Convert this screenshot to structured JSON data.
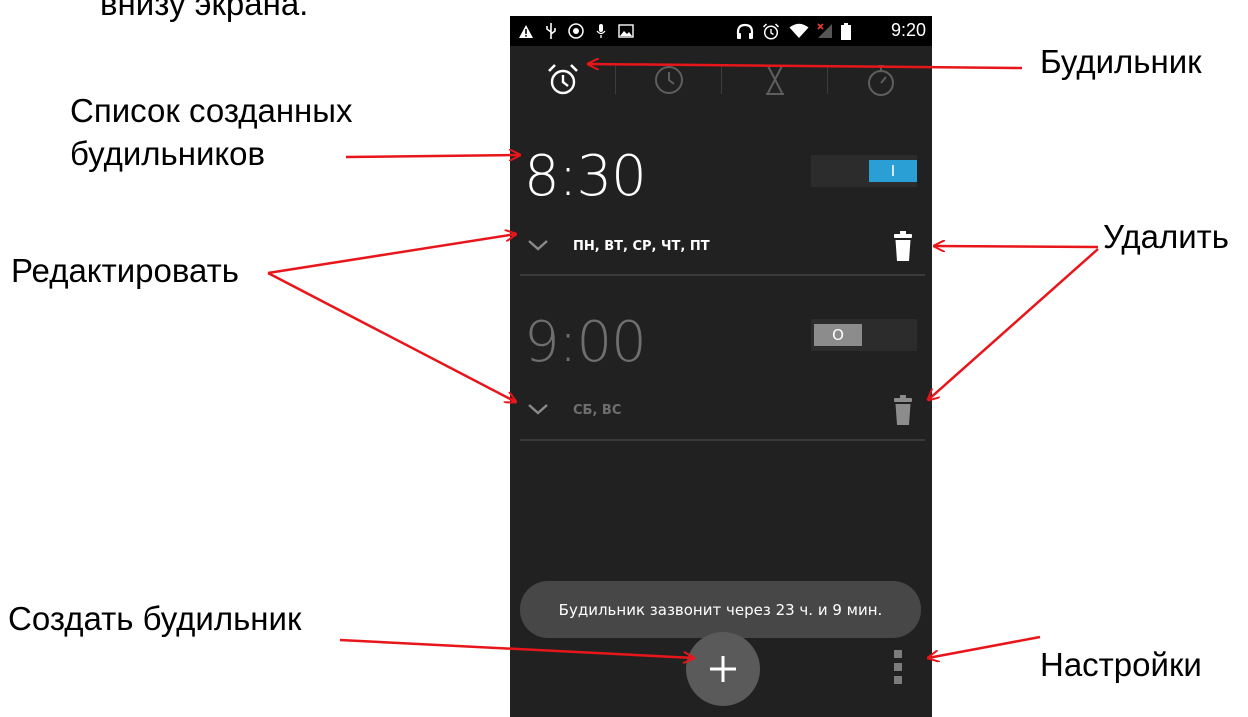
{
  "slide": {
    "header_cut": "внизу экрана.",
    "label_list_line1": "Список созданных",
    "label_list_line2": "будильников",
    "label_edit": "Редактировать",
    "label_create": "Создать будильник",
    "label_alarm": "Будильник",
    "label_delete": "Удалить",
    "label_settings": "Настройки",
    "arrow_color": "#e8161b"
  },
  "status_bar": {
    "time": "9:20",
    "icons": [
      "warning-icon",
      "usb-icon",
      "fm-radio-icon",
      "mic-icon",
      "image-icon",
      "headphones-icon",
      "alarm-status-icon",
      "wifi-icon",
      "signal-off-icon",
      "battery-icon"
    ]
  },
  "tabs": [
    {
      "name": "alarm-tab",
      "icon": "alarm-clock-icon",
      "selected": true
    },
    {
      "name": "world-clock-tab",
      "icon": "clock-icon",
      "selected": false
    },
    {
      "name": "timer-tab",
      "icon": "hourglass-icon",
      "selected": false
    },
    {
      "name": "stopwatch-tab",
      "icon": "stopwatch-icon",
      "selected": false
    }
  ],
  "alarms": [
    {
      "time": "8:30",
      "enabled": true,
      "toggle_text": "I",
      "days": "ПН, ВТ, СР, ЧТ, ПТ"
    },
    {
      "time": "9:00",
      "enabled": false,
      "toggle_text": "O",
      "days": "СБ, ВС"
    }
  ],
  "toast": "Будильник зазвонит через 23 ч. и 9 мин.",
  "colors": {
    "background": "#212121",
    "toggle_on": "#2a9fd6",
    "toggle_off": "#8c8c8c",
    "text_active": "#ffffff",
    "text_inactive": "#6f6f6f"
  }
}
